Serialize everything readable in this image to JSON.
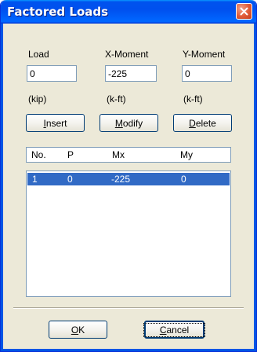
{
  "window": {
    "title": "Factored Loads"
  },
  "fields": [
    {
      "label": "Load",
      "value": "0",
      "unit": "(kip)"
    },
    {
      "label": "X-Moment",
      "value": "-225",
      "unit": "(k-ft)"
    },
    {
      "label": "Y-Moment",
      "value": "0",
      "unit": "(k-ft)"
    }
  ],
  "buttons": {
    "insert": {
      "mnemonic": "I",
      "rest": "nsert"
    },
    "modify": {
      "mnemonic": "M",
      "rest": "odify"
    },
    "delete": {
      "mnemonic": "D",
      "rest": "elete"
    },
    "ok": {
      "mnemonic": "O",
      "rest": "K"
    },
    "cancel": {
      "mnemonic": "C",
      "rest": "ancel"
    }
  },
  "list": {
    "columns": [
      "No.",
      "P",
      "Mx",
      "My"
    ],
    "rows": [
      {
        "no": "1",
        "p": "0",
        "mx": "-225",
        "my": "0",
        "selected": true
      }
    ]
  }
}
